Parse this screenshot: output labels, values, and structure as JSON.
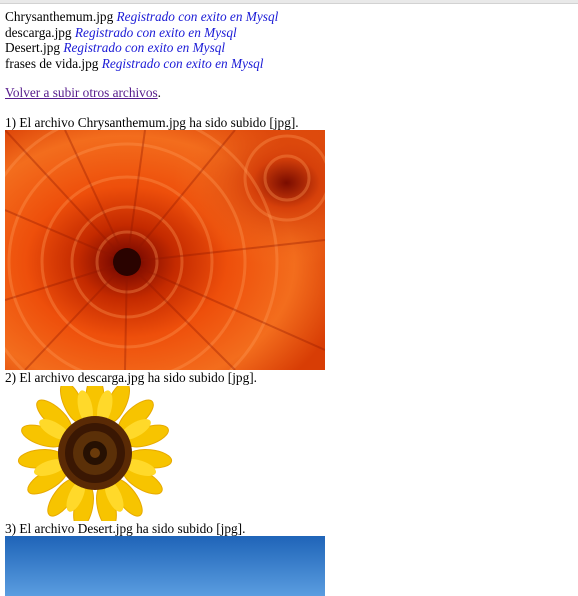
{
  "uploads": [
    {
      "file": "Chrysanthemum.jpg",
      "status": "Registrado con exito en Mysql"
    },
    {
      "file": "descarga.jpg",
      "status": "Registrado con exito en Mysql"
    },
    {
      "file": "Desert.jpg",
      "status": "Registrado con exito en Mysql"
    },
    {
      "file": "frases de vida.jpg",
      "status": "Registrado con exito en Mysql"
    }
  ],
  "back_link": {
    "text": "Volver a subir otros archivos",
    "suffix": "."
  },
  "results": [
    {
      "caption": "1) El archivo Chrysanthemum.jpg ha sido subido [jpg].",
      "image": "orange-chrysanthemum-photo"
    },
    {
      "caption": "2) El archivo descarga.jpg ha sido subido [jpg].",
      "image": "sunflower-photo"
    },
    {
      "caption": "3) El archivo Desert.jpg ha sido subido [jpg].",
      "image": "blue-sky-photo"
    }
  ],
  "colors": {
    "status_text": "#1a1ad6",
    "link_visited": "#551a8b"
  }
}
